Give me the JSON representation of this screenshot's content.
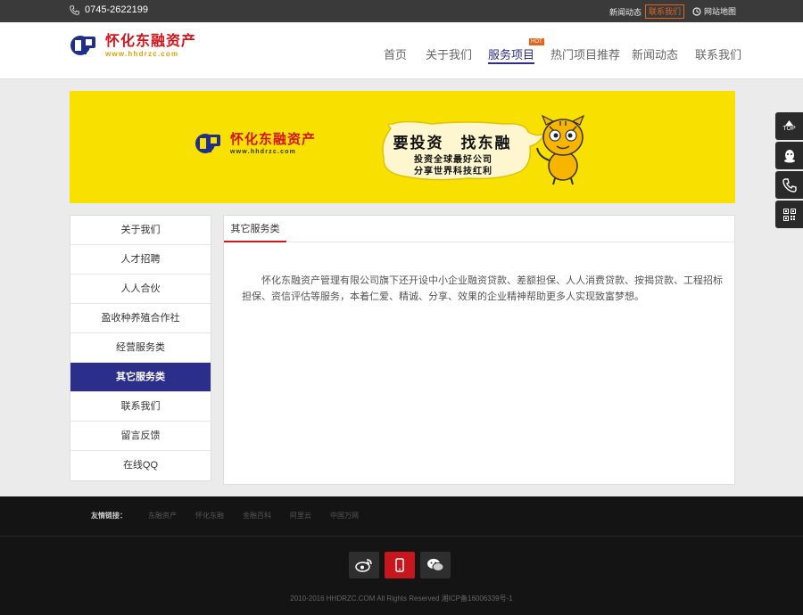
{
  "topbar": {
    "phone": "0745-2622199",
    "news_label": "新闻动态",
    "contact_label": "联系我们",
    "sitemap_label": "网站地图"
  },
  "logo": {
    "name": "怀化东融资产",
    "url": "www.hhdrzc.com"
  },
  "nav": {
    "items": [
      {
        "label": "首页"
      },
      {
        "label": "关于我们"
      },
      {
        "label": "服务项目"
      },
      {
        "label": "热门项目推荐"
      },
      {
        "label": "新闻动态"
      },
      {
        "label": "联系我们"
      }
    ],
    "active_index": 2,
    "hot_badge": "HOT"
  },
  "banner": {
    "logo_name": "怀化东融资产",
    "logo_url": "www.hhdrzc.com",
    "slogan_main": "要投资　找东融",
    "slogan_sub1": "投资全球最好公司",
    "slogan_sub2": "分享世界科技红利",
    "background_color": "#f8e000"
  },
  "sidebar": {
    "items": [
      {
        "label": "关于我们"
      },
      {
        "label": "人才招聘"
      },
      {
        "label": "人人合伙"
      },
      {
        "label": "盈收种养殖合作社"
      },
      {
        "label": "经营服务类"
      },
      {
        "label": "其它服务类"
      },
      {
        "label": "联系我们"
      },
      {
        "label": "留言反馈"
      },
      {
        "label": "在线QQ"
      }
    ],
    "active_index": 5
  },
  "content": {
    "tab_title": "其它服务类",
    "body": "怀化东融资产管理有限公司旗下还开设中小企业融资贷款、差额担保、人人消费贷款、按揭贷款、工程招标担保、资信评估等服务，本着仁爱、精诚、分享、效果的企业精神帮助更多人实现致富梦想。"
  },
  "float_tools": {
    "top_label": "TOP",
    "icons": [
      "arrow-up-icon",
      "qq-icon",
      "phone-icon",
      "qrcode-icon"
    ]
  },
  "footer": {
    "friend_links_title": "友情链接：",
    "friend_links": [
      "东融资产",
      "怀化东融",
      "金融百科",
      "阿里云",
      "中国万网"
    ],
    "social_icons": [
      "weibo-icon",
      "mobile-icon",
      "wechat-icon"
    ],
    "copyright": "2010-2016 HHDRZC.COM All Rights Reserved 湘ICP备16006339号-1"
  },
  "colors": {
    "brand_blue": "#2b2e8a",
    "brand_red": "#d4141a",
    "accent_orange": "#e4631d",
    "topbar_bg": "#3a3a3a",
    "footer_bg": "#141414"
  }
}
